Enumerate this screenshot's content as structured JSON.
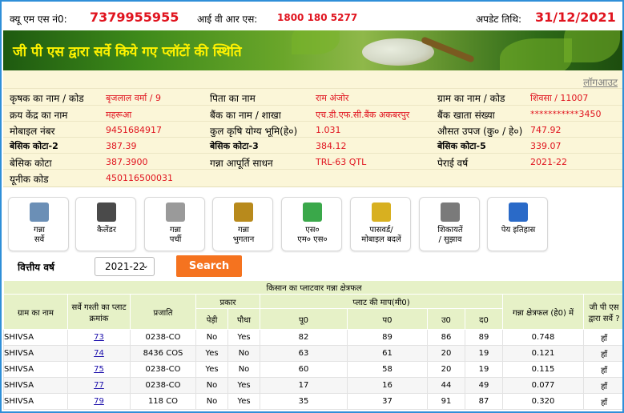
{
  "topbar": {
    "qms_label": "क्यू एम एस नं0:",
    "qms_value": "7379955955",
    "ivr_label": "आई वी आर एस:",
    "ivr_value": "1800 180 5277",
    "update_label": "अपडेट तिथि:",
    "update_value": "31/12/2021"
  },
  "banner": {
    "title": "जी पी एस द्वारा सर्वे किये गए प्लॉटों की स्थिति"
  },
  "info": {
    "logout": "लॉगआउट",
    "rows": [
      [
        {
          "k": "कृषक का नाम / कोड",
          "v": "बृजलाल वर्मा / 9"
        },
        {
          "k": "पिता का नाम",
          "v": "राम अंजोर"
        },
        {
          "k": "ग्राम का नाम / कोड",
          "v": "शिवसा / 11007"
        }
      ],
      [
        {
          "k": "क्रय केंद्र का नाम",
          "v": "महरूआ"
        },
        {
          "k": "बैंक का नाम / शाखा",
          "v": "एच.डी.एफ.सी.बैंक अकबरपुर"
        },
        {
          "k": "बैंक खाता संख्या",
          "v": "***********3450"
        }
      ],
      [
        {
          "k": "मोबाइल नंबर",
          "v": "9451684917"
        },
        {
          "k": "कुल कृषि योग्य भूमि(हे०)",
          "v": "1.031"
        },
        {
          "k": "औसत उपज (कु० / हे०)",
          "v": "747.92"
        }
      ],
      [
        {
          "k": "बेसिक कोटा-2",
          "v": "387.39"
        },
        {
          "k": "बेसिक कोटा-3",
          "v": "384.12"
        },
        {
          "k": "बेसिक कोटा-5",
          "v": "339.07"
        }
      ],
      [
        {
          "k": "बेसिक कोटा",
          "v": "387.3900"
        },
        {
          "k": "गन्ना आपूर्ति साधन",
          "v": "TRL-63 QTL"
        },
        {
          "k": "पेराई वर्ष",
          "v": "2021-22"
        }
      ],
      [
        {
          "k": "यूनीक कोड",
          "v": "450116500031"
        }
      ]
    ]
  },
  "icons": [
    {
      "name": "ganna-survey",
      "icon": "clipboard-icon",
      "label1": "गन्ना",
      "label2": "सर्वे",
      "color": "#6b8fb6"
    },
    {
      "name": "calendar",
      "icon": "calendar-icon",
      "label1": "कैलेंडर",
      "label2": "",
      "color": "#4a4a4a"
    },
    {
      "name": "ganna-parchi",
      "icon": "receipt-icon",
      "label1": "गन्ना",
      "label2": "पर्ची",
      "color": "#9a9a9a"
    },
    {
      "name": "ganna-payment",
      "icon": "coins-icon",
      "label1": "गन्ना",
      "label2": "भुगतान",
      "color": "#b88a1c"
    },
    {
      "name": "sms",
      "icon": "sms-icon",
      "label1": "एस०",
      "label2": "एम० एस०",
      "color": "#3aa84a"
    },
    {
      "name": "password-mobile",
      "icon": "lock-phone-icon",
      "label1": "पासवर्ड/",
      "label2": "मोबाइल बदलें",
      "color": "#d8b020"
    },
    {
      "name": "complaints",
      "icon": "complaint-icon",
      "label1": "शिकायतें",
      "label2": "/ सुझाव",
      "color": "#7a7a7a"
    },
    {
      "name": "pay-history",
      "icon": "globe-icon",
      "label1": "पेय इतिहास",
      "label2": "",
      "color": "#2a6ac8"
    }
  ],
  "filter": {
    "label": "वित्तीय वर्ष",
    "year": "2021-22",
    "search": "Search"
  },
  "table": {
    "caption": "किसान का प्लाटवार गन्ना क्षेत्रफल",
    "headers": {
      "village": "ग्राम का नाम",
      "survey": "सर्वे गश्ती का प्लाट क्रमांक",
      "variety": "प्रजाति",
      "type": "प्रकार",
      "ratoon": "पेड़ी",
      "plant": "पौधा",
      "dims": "प्लाट की माप(मी0)",
      "east": "पू0",
      "west": "प0",
      "north": "उ0",
      "south": "द0",
      "area": "गन्ना क्षेत्रफल (हे0) में",
      "gps": "जी पी एस द्वारा सर्वे ?"
    },
    "rows": [
      {
        "village": "SHIVSA",
        "plot": "73",
        "variety": "0238-CO",
        "ratoon": "No",
        "plant": "Yes",
        "e": "82",
        "w": "89",
        "n": "86",
        "s": "89",
        "area": "0.748",
        "gps": "हाँ"
      },
      {
        "village": "SHIVSA",
        "plot": "74",
        "variety": "8436 COS",
        "ratoon": "Yes",
        "plant": "No",
        "e": "63",
        "w": "61",
        "n": "20",
        "s": "19",
        "area": "0.121",
        "gps": "हाँ"
      },
      {
        "village": "SHIVSA",
        "plot": "75",
        "variety": "0238-CO",
        "ratoon": "Yes",
        "plant": "No",
        "e": "60",
        "w": "58",
        "n": "20",
        "s": "19",
        "area": "0.115",
        "gps": "हाँ"
      },
      {
        "village": "SHIVSA",
        "plot": "77",
        "variety": "0238-CO",
        "ratoon": "No",
        "plant": "Yes",
        "e": "17",
        "w": "16",
        "n": "44",
        "s": "49",
        "area": "0.077",
        "gps": "हाँ"
      },
      {
        "village": "SHIVSA",
        "plot": "79",
        "variety": "118 CO",
        "ratoon": "No",
        "plant": "Yes",
        "e": "35",
        "w": "37",
        "n": "91",
        "s": "87",
        "area": "0.320",
        "gps": "हाँ"
      }
    ]
  }
}
